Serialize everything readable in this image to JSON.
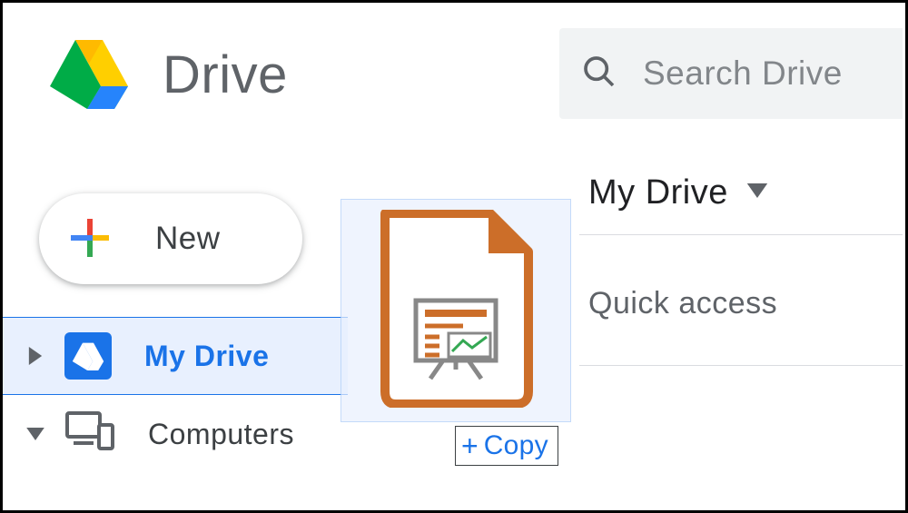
{
  "header": {
    "title": "Drive"
  },
  "search": {
    "placeholder": "Search Drive"
  },
  "sidebar": {
    "new_label": "New",
    "items": [
      {
        "label": "My Drive",
        "selected": true
      },
      {
        "label": "Computers",
        "selected": false
      }
    ]
  },
  "main": {
    "breadcrumb": "My Drive",
    "section": "Quick access"
  },
  "drag": {
    "tooltip": "Copy"
  }
}
